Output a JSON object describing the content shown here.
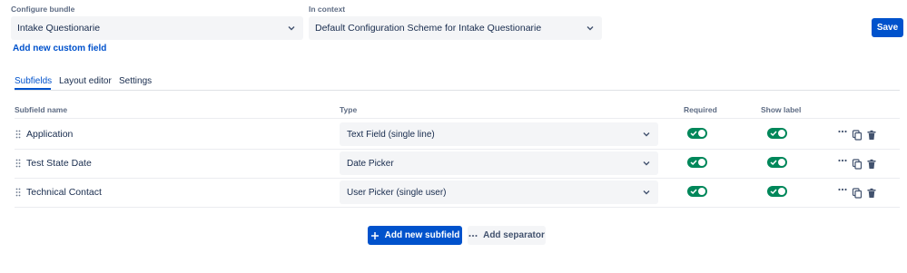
{
  "config": {
    "bundle_label": "Configure bundle",
    "bundle_value": "Intake Questionarie",
    "context_label": "In context",
    "context_value": "Default Configuration Scheme for Intake Questionarie",
    "save_label": "Save",
    "add_custom_field": "Add new custom field"
  },
  "tabs": [
    {
      "label": "Subfields",
      "active": true
    },
    {
      "label": "Layout editor",
      "active": false
    },
    {
      "label": "Settings",
      "active": false
    }
  ],
  "table": {
    "headers": {
      "name": "Subfield name",
      "type": "Type",
      "required": "Required",
      "show_label": "Show label"
    },
    "rows": [
      {
        "name": "Application",
        "type": "Text Field (single line)",
        "required": true,
        "show_label": true
      },
      {
        "name": "Test State Date",
        "type": "Date Picker",
        "required": true,
        "show_label": true
      },
      {
        "name": "Technical Contact",
        "type": "User Picker (single user)",
        "required": true,
        "show_label": true
      }
    ]
  },
  "actions": {
    "add_subfield": "Add new subfield",
    "add_separator": "Add separator"
  },
  "colors": {
    "primary": "#0052cc",
    "toggle_on": "#00875a",
    "field_bg": "#f4f5f7"
  },
  "icons": [
    "chevron-down-icon",
    "drag-handle-icon",
    "check-icon",
    "more-icon",
    "copy-icon",
    "trash-icon",
    "plus-icon",
    "ellipsis-icon"
  ]
}
